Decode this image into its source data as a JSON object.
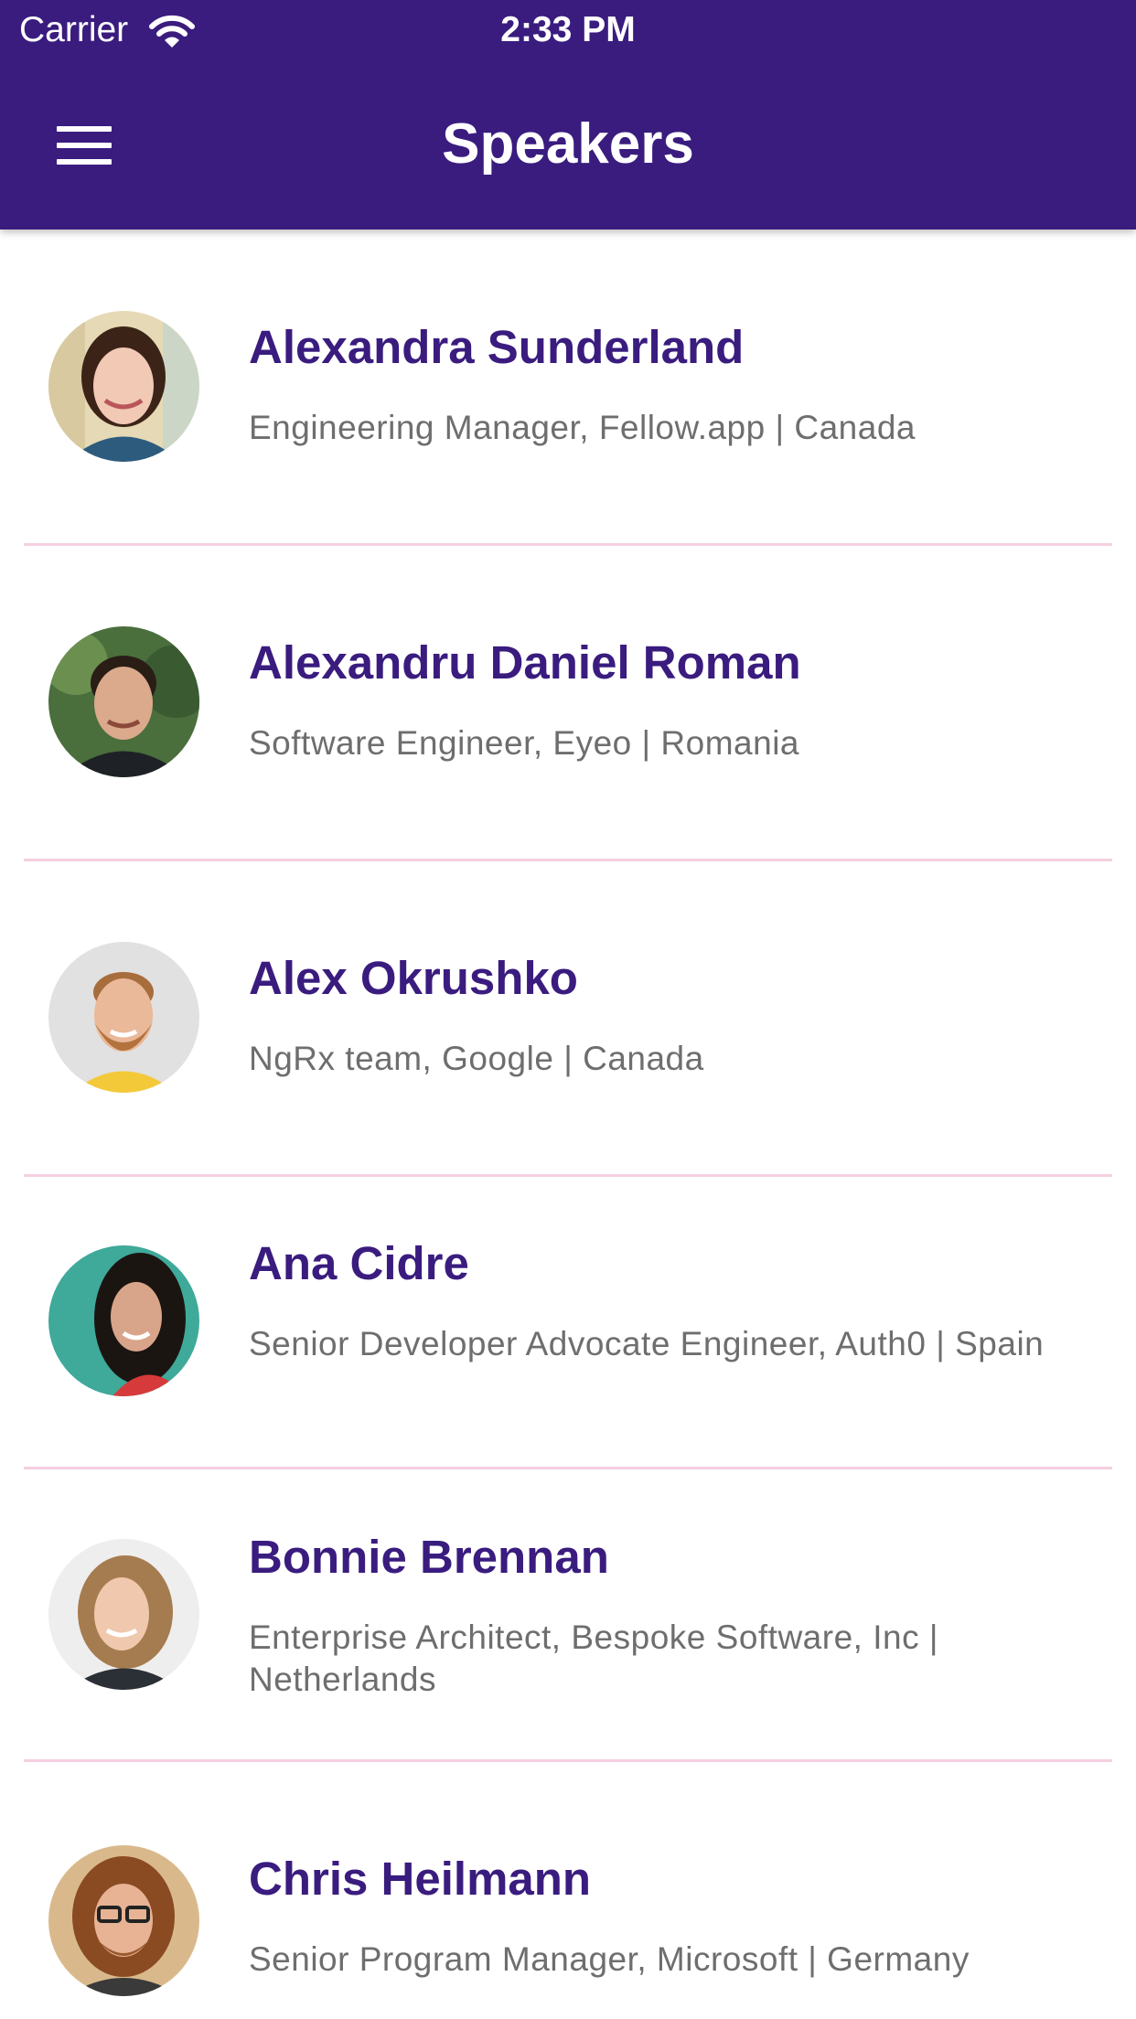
{
  "status_bar": {
    "carrier": "Carrier",
    "time": "2:33 PM",
    "wifi_icon": "wifi-icon"
  },
  "header": {
    "title": "Speakers",
    "menu_icon": "hamburger-menu-icon",
    "background_color": "#3a1c7f"
  },
  "speakers": [
    {
      "name": "Alexandra Sunderland",
      "subtitle": "Engineering Manager, Fellow.app | Canada",
      "avatar": "speaker-photo"
    },
    {
      "name": "Alexandru Daniel Roman",
      "subtitle": "Software Engineer, Eyeo | Romania",
      "avatar": "speaker-photo"
    },
    {
      "name": "Alex Okrushko",
      "subtitle": "NgRx team, Google | Canada",
      "avatar": "speaker-photo"
    },
    {
      "name": "Ana Cidre",
      "subtitle": "Senior Developer Advocate Engineer, Auth0 | Spain",
      "avatar": "speaker-photo"
    },
    {
      "name": "Bonnie Brennan",
      "subtitle": "Enterprise Architect, Bespoke Software, Inc | Netherlands",
      "avatar": "speaker-photo"
    },
    {
      "name": "Chris Heilmann",
      "subtitle": "Senior Program Manager, Microsoft | Germany",
      "avatar": "speaker-photo"
    }
  ],
  "colors": {
    "name_text": "#3a1c7f",
    "subtitle_text": "#6e6e6e",
    "divider": "#f5cfe0"
  }
}
